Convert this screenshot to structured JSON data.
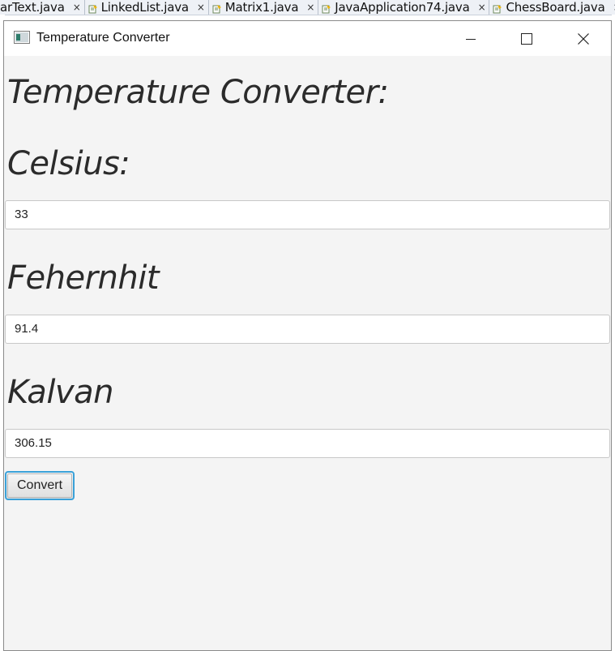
{
  "ide": {
    "tabs": [
      {
        "label": "arText.java"
      },
      {
        "label": "LinkedList.java"
      },
      {
        "label": "Matrix1.java"
      },
      {
        "label": "JavaApplication74.java"
      },
      {
        "label": "ChessBoard.java"
      }
    ],
    "close_glyph": "×"
  },
  "window": {
    "title": "Temperature Converter"
  },
  "app": {
    "heading": "Temperature Converter:",
    "celsius_label": "Celsius:",
    "celsius_value": "33",
    "fahrenheit_label": "Fehernhit",
    "fahrenheit_value": "91.4",
    "kelvin_label": "Kalvan",
    "kelvin_value": "306.15",
    "convert_label": "Convert"
  },
  "colors": {
    "focus_accent": "#3aa1d8",
    "window_bg": "#f4f4f4"
  }
}
